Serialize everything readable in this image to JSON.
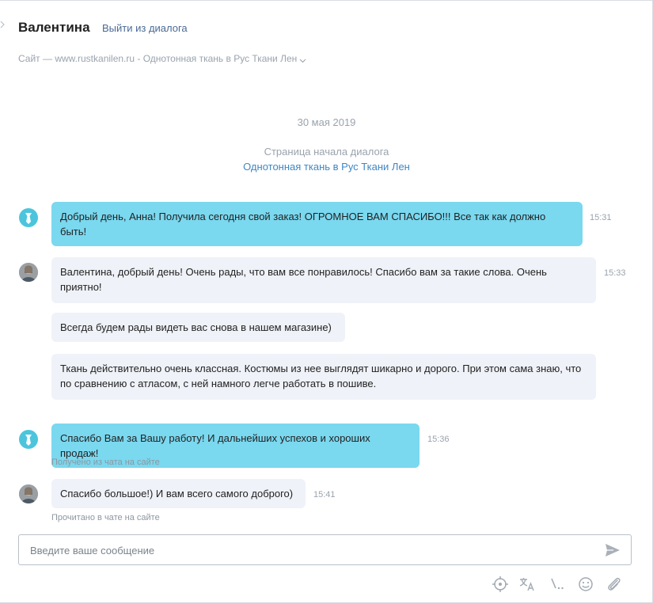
{
  "header": {
    "contact_name": "Валентина",
    "leave_label": "Выйти из диалога",
    "source": "Сайт — www.rustkanilen.ru - Однотонная ткань в Рус Ткани Лен"
  },
  "conversation": {
    "date": "30 мая 2019",
    "start_label": "Страница начала диалога",
    "start_link": "Однотонная ткань в Рус Ткани Лен"
  },
  "messages": [
    {
      "text": "Добрый день, Анна! Получила сегодня свой заказ! ОГРОМНОЕ ВАМ СПАСИБО!!! Все так как должно быть!",
      "time": "15:31"
    },
    {
      "text": "Валентина, добрый день! Очень рады, что вам все понравилось! Спасибо вам за такие слова. Очень приятно!",
      "time": "15:33"
    },
    {
      "text": "Всегда будем рады видеть вас снова в нашем магазине)"
    },
    {
      "text": "Ткань действительно очень классная. Костюмы из нее выглядят шикарно и дорого. При этом сама знаю, что по сравнению с атласом, с ней намного легче работать в пошиве."
    },
    {
      "text": "Спасибо Вам за Вашу работу! И дальнейших успехов и хороших продаж!",
      "time": "15:36",
      "note": "Получено из чата на сайте"
    },
    {
      "text": "Спасибо большое!) И вам всего самого доброго)",
      "time": "15:41",
      "note": "Прочитано в чате на сайте"
    }
  ],
  "composer": {
    "placeholder": "Введите ваше сообщение"
  },
  "colors": {
    "client_bubble": "#7ad8ef",
    "agent_bubble": "#eff2f8",
    "link": "#3f87c5"
  },
  "icons": [
    "send-icon",
    "target-icon",
    "translate-icon",
    "shortcut-icon",
    "emoji-icon",
    "attachment-icon"
  ]
}
